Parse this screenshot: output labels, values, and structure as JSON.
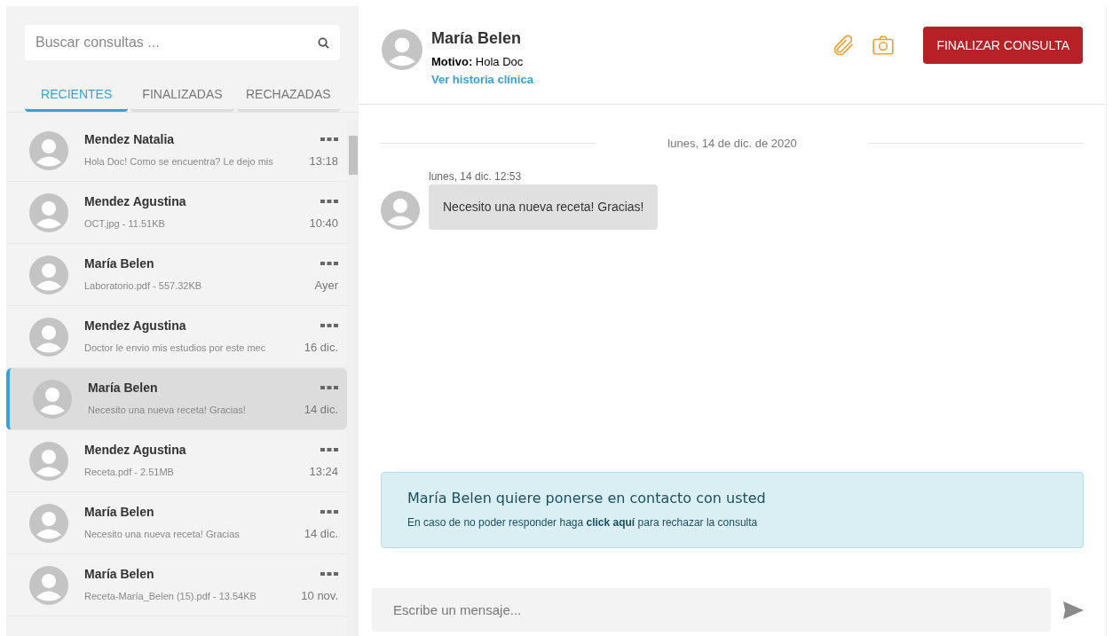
{
  "search": {
    "placeholder": "Buscar consultas ..."
  },
  "tabs": [
    {
      "label": "RECIENTES",
      "selected": true
    },
    {
      "label": "FINALIZADAS",
      "selected": false
    },
    {
      "label": "RECHAZADAS",
      "selected": false
    }
  ],
  "conversations": [
    {
      "name": "Mendez Natalia",
      "preview": "Hola Doc! Como se encuentra? Le dejo mis",
      "time": "13:18",
      "selected": false
    },
    {
      "name": "Mendez Agustina",
      "preview": "OCT.jpg - 11.51KB",
      "time": "10:40",
      "selected": false
    },
    {
      "name": "María Belen",
      "preview": "Laboratorio.pdf - 557.32KB",
      "time": "Ayer",
      "selected": false
    },
    {
      "name": "Mendez Agustina",
      "preview": "Doctor le envio mis estudios por este mec",
      "time": "16 dic.",
      "selected": false
    },
    {
      "name": "María Belen",
      "preview": "Necesito una nueva receta! Gracias!",
      "time": "14 dic.",
      "selected": true
    },
    {
      "name": "Mendez Agustina",
      "preview": "Receta.pdf - 2.51MB",
      "time": "13:24",
      "selected": false
    },
    {
      "name": "María Belen",
      "preview": "Necesito una nueva receta! Gracias",
      "time": "14 dic.",
      "selected": false
    },
    {
      "name": "María Belen",
      "preview": "Receta-María_Belen (15).pdf - 13.54KB",
      "time": "10 nov.",
      "selected": false
    }
  ],
  "header": {
    "name": "María Belen",
    "reason_label": "Motivo:",
    "reason": "Hola Doc",
    "history_link": "Ver historia clínica",
    "finish_button": "FINALIZAR CONSULTA"
  },
  "date_divider": "lunes, 14 de dic. de 2020",
  "messages": [
    {
      "timestamp": "lunes, 14 dic. 12:53",
      "text": "Necesito una nueva receta! Gracias!"
    }
  ],
  "notice": {
    "title": "María Belen quiere ponerse en contacto con usted",
    "text_before": "En caso de no poder responder haga",
    "link": "click aquí",
    "text_after": "para rechazar la consulta"
  },
  "composer": {
    "placeholder": "Escribe un mensaje..."
  }
}
